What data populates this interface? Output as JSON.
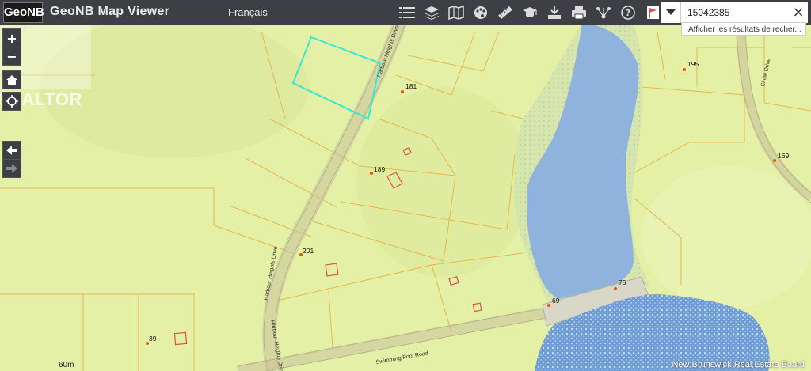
{
  "header": {
    "logo_text": "GeoNB",
    "title": "GeoNB Map Viewer",
    "language_link": "Français"
  },
  "toolbar": {
    "tools": [
      {
        "icon": "list-icon"
      },
      {
        "icon": "layers-icon"
      },
      {
        "icon": "basemap-icon"
      },
      {
        "icon": "palette-icon"
      },
      {
        "icon": "measure-ruler-icon"
      },
      {
        "icon": "graduation-cap-icon"
      },
      {
        "icon": "download-icon"
      },
      {
        "icon": "print-icon"
      },
      {
        "icon": "share-icon"
      },
      {
        "icon": "help-icon"
      },
      {
        "icon": "flag-icon"
      }
    ]
  },
  "search": {
    "value": "15042385",
    "suggestion": "Afficher les résultats de recher..."
  },
  "nav": {
    "zoom_in": "+",
    "zoom_out": "−"
  },
  "watermark": {
    "text": "REALTOR"
  },
  "map": {
    "road_labels": [
      "Harbour Heights Drive",
      "Harbour Heights Drive",
      "Harbour Heights Drive",
      "Swimming Pool Road",
      "Circle Drive"
    ],
    "civic_numbers": [
      "181",
      "189",
      "201",
      "39",
      "195",
      "169",
      "69",
      "75"
    ],
    "contour_label": "60m",
    "colors": {
      "land": "#e4f0a6",
      "lot_line": "#e5b94e",
      "lake": "#8fb3dc",
      "selected_parcel": "#35e8d6",
      "building": "#d9534f",
      "civic_point": "#e05a00"
    }
  },
  "footer": {
    "copyright": "New Brunswick Real Estate Board"
  }
}
